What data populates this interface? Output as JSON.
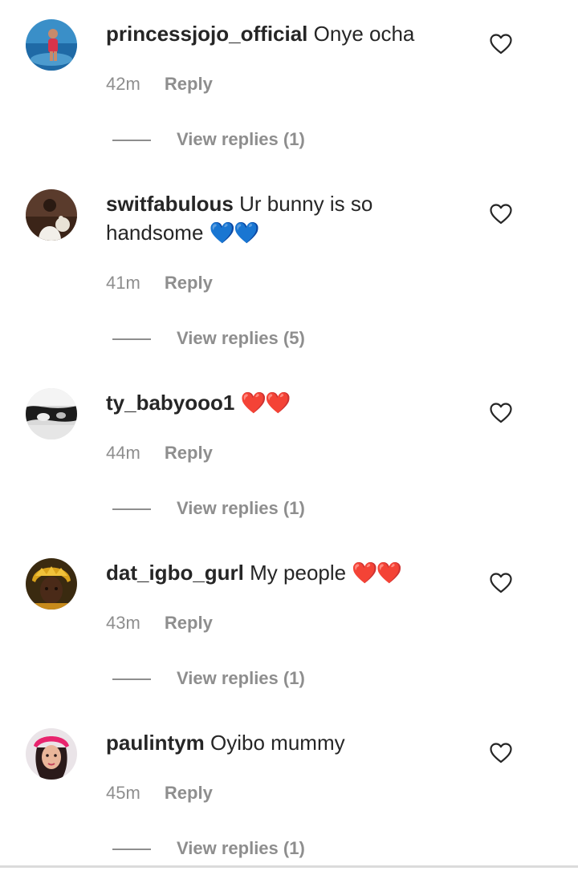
{
  "comments": [
    {
      "username": "princessjojo_official",
      "text": "Onye ocha",
      "emoji": "",
      "emoji_type": "",
      "time": "42m",
      "reply_label": "Reply",
      "view_replies": "View replies (1)"
    },
    {
      "username": "switfabulous",
      "text": "Ur bunny is so handsome",
      "emoji": "💙💙",
      "emoji_type": "blue-heart",
      "time": "41m",
      "reply_label": "Reply",
      "view_replies": "View replies (5)"
    },
    {
      "username": "ty_babyooo1",
      "text": "",
      "emoji": "❤️❤️",
      "emoji_type": "red-heart",
      "time": "44m",
      "reply_label": "Reply",
      "view_replies": "View replies (1)"
    },
    {
      "username": "dat_igbo_gurl",
      "text": "My people",
      "emoji": "❤️❤️",
      "emoji_type": "red-heart",
      "time": "43m",
      "reply_label": "Reply",
      "view_replies": "View replies (1)"
    },
    {
      "username": "paulintym",
      "text": "Oyibo mummy",
      "emoji": "",
      "emoji_type": "",
      "time": "45m",
      "reply_label": "Reply",
      "view_replies": "View replies (1)"
    }
  ],
  "icons": {
    "like": "heart-outline-icon"
  },
  "colors": {
    "username": "#262626",
    "text": "#262626",
    "meta": "#8e8e8e",
    "red_heart": "#e0141e",
    "blue_heart": "#1e88e5",
    "background": "#ffffff"
  }
}
